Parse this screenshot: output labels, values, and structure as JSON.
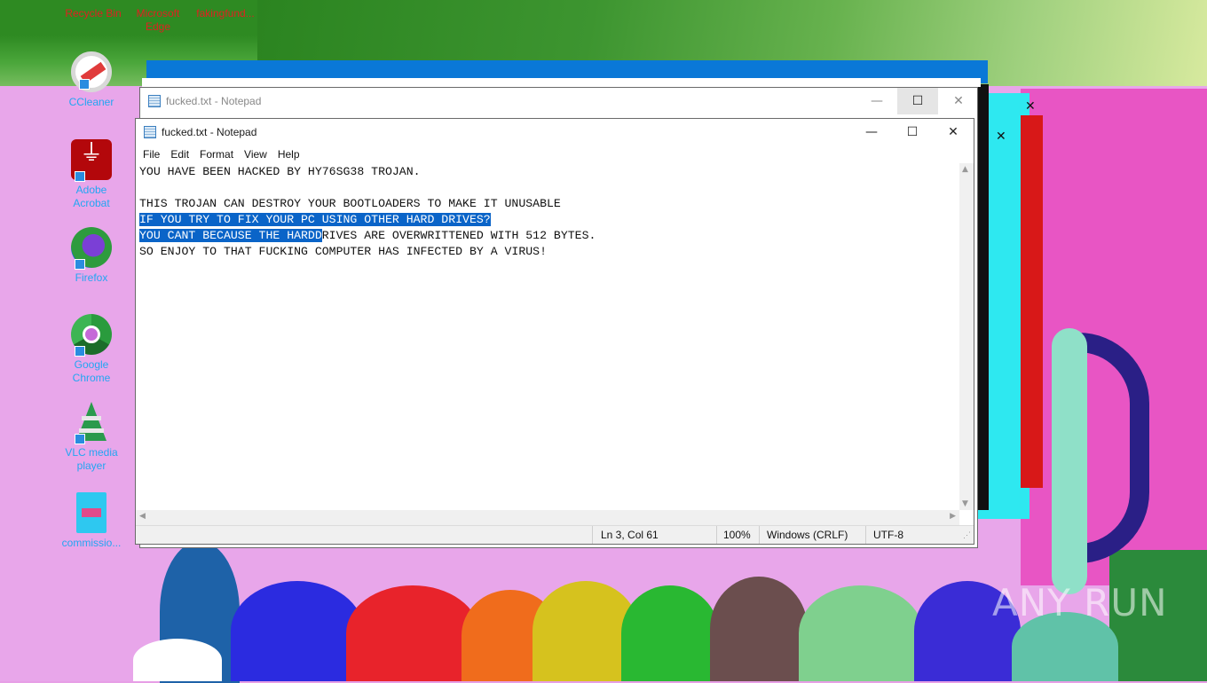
{
  "desktop": {
    "top_labels": [
      "Recycle Bin",
      "Microsoft Edge",
      "fakingfund..."
    ],
    "icons": [
      {
        "label": "CCleaner",
        "icon": "ccleaner-icon"
      },
      {
        "label": "Adobe Acrobat",
        "icon": "acrobat-icon"
      },
      {
        "label": "Firefox",
        "icon": "firefox-icon"
      },
      {
        "label": "Google Chrome",
        "icon": "chrome-icon"
      },
      {
        "label": "VLC media player",
        "icon": "vlc-icon"
      },
      {
        "label": "commissio...",
        "icon": "file-icon"
      }
    ],
    "watermark": "ANY RUN"
  },
  "back_window": {
    "title": "fucked.txt - Notepad"
  },
  "notepad": {
    "title": "fucked.txt - Notepad",
    "menu": [
      "File",
      "Edit",
      "Format",
      "View",
      "Help"
    ],
    "lines": {
      "l1": "YOU HAVE BEEN HACKED BY HY76SG38 TROJAN.",
      "l2": "",
      "l3": "THIS TROJAN CAN DESTROY YOUR BOOTLOADERS TO MAKE IT UNUSABLE",
      "l4": "IF YOU TRY TO FIX YOUR PC USING OTHER HARD DRIVES?",
      "l5_selected": "YOU CANT BECAUSE THE HARDD",
      "l5_rest": "RIVES ARE OVERWRITTENED WITH 512 BYTES.",
      "l6": "SO ENJOY TO THAT FUCKING COMPUTER HAS INFECTED BY A VIRUS!"
    },
    "status": {
      "position": "Ln 3, Col 61",
      "zoom": "100%",
      "line_ending": "Windows (CRLF)",
      "encoding": "UTF-8"
    }
  },
  "colors": {
    "selection": "#0a64c8",
    "desktop_label": "#22a6f2",
    "title_blue": "#0a78d7"
  }
}
